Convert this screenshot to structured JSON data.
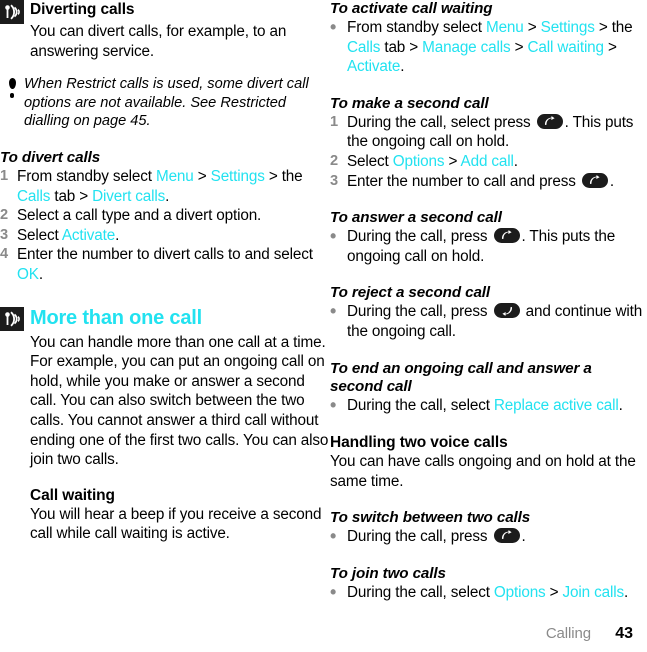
{
  "footer": {
    "chapter": "Calling",
    "page": "43"
  },
  "left": {
    "diverting": {
      "icon": "antenna-broadcast-icon",
      "heading": "Diverting calls",
      "intro": "You can divert calls, for example, to an answering service.",
      "note": {
        "icon": "exclamation-bullet-icon",
        "part1": "When ",
        "em1": "Restrict calls",
        "part2": " is used, some divert call options are not available. See ",
        "em2": "Restricted dialling",
        "part3": " on page 45."
      },
      "procedure": {
        "title": "To divert calls",
        "steps": [
          {
            "marker": "1",
            "segments": [
              {
                "t": "From standby select ",
                "c": "plain"
              },
              {
                "t": "Menu",
                "c": "menu"
              },
              {
                "t": " > ",
                "c": "plain"
              },
              {
                "t": "Settings",
                "c": "menu"
              },
              {
                "t": " > the ",
                "c": "plain"
              },
              {
                "t": "Calls",
                "c": "menu"
              },
              {
                "t": " tab > ",
                "c": "plain"
              },
              {
                "t": "Divert calls",
                "c": "menu"
              },
              {
                "t": ".",
                "c": "plain"
              }
            ]
          },
          {
            "marker": "2",
            "segments": [
              {
                "t": "Select a call type and a divert option.",
                "c": "plain"
              }
            ]
          },
          {
            "marker": "3",
            "segments": [
              {
                "t": "Select ",
                "c": "plain"
              },
              {
                "t": "Activate",
                "c": "menu"
              },
              {
                "t": ".",
                "c": "plain"
              }
            ]
          },
          {
            "marker": "4",
            "segments": [
              {
                "t": "Enter the number to divert calls to and select ",
                "c": "plain"
              },
              {
                "t": "OK",
                "c": "menu"
              },
              {
                "t": ".",
                "c": "plain"
              }
            ]
          }
        ]
      }
    },
    "more_than_one": {
      "icon": "antenna-broadcast-icon",
      "heading": "More than one call",
      "intro": "You can handle more than one call at a time. For example, you can put an ongoing call on hold, while you make or answer a second call. You can also switch between the two calls. You cannot answer a third call without ending one of the first two calls. You can also join two calls.",
      "call_waiting": {
        "heading": "Call waiting",
        "text": "You will hear a beep if you receive a second call while call waiting is active."
      }
    }
  },
  "right": {
    "activate_call_waiting": {
      "title": "To activate call waiting",
      "steps": [
        {
          "marker": "•",
          "segments": [
            {
              "t": "From standby select ",
              "c": "plain"
            },
            {
              "t": "Menu",
              "c": "menu"
            },
            {
              "t": " > ",
              "c": "plain"
            },
            {
              "t": "Settings",
              "c": "menu"
            },
            {
              "t": " > the ",
              "c": "plain"
            },
            {
              "t": "Calls",
              "c": "menu"
            },
            {
              "t": " tab > ",
              "c": "plain"
            },
            {
              "t": "Manage calls",
              "c": "menu"
            },
            {
              "t": " > ",
              "c": "plain"
            },
            {
              "t": "Call waiting",
              "c": "menu"
            },
            {
              "t": " > ",
              "c": "plain"
            },
            {
              "t": "Activate",
              "c": "menu"
            },
            {
              "t": ".",
              "c": "plain"
            }
          ]
        }
      ]
    },
    "make_second_call": {
      "title": "To make a second call",
      "steps": [
        {
          "marker": "1",
          "segments": [
            {
              "t": "During the call, select press ",
              "c": "plain"
            },
            {
              "t": "",
              "c": "call-key"
            },
            {
              "t": ". This puts the ongoing call on hold.",
              "c": "plain"
            }
          ]
        },
        {
          "marker": "2",
          "segments": [
            {
              "t": "Select ",
              "c": "plain"
            },
            {
              "t": "Options",
              "c": "menu"
            },
            {
              "t": " > ",
              "c": "plain"
            },
            {
              "t": "Add call",
              "c": "menu"
            },
            {
              "t": ".",
              "c": "plain"
            }
          ]
        },
        {
          "marker": "3",
          "segments": [
            {
              "t": "Enter the number to call and press ",
              "c": "plain"
            },
            {
              "t": "",
              "c": "call-key"
            },
            {
              "t": ".",
              "c": "plain"
            }
          ]
        }
      ]
    },
    "answer_second_call": {
      "title": "To answer a second call",
      "steps": [
        {
          "marker": "•",
          "segments": [
            {
              "t": "During the call, press ",
              "c": "plain"
            },
            {
              "t": "",
              "c": "call-key"
            },
            {
              "t": ". This puts the ongoing call on hold.",
              "c": "plain"
            }
          ]
        }
      ]
    },
    "reject_second_call": {
      "title": "To reject a second call",
      "steps": [
        {
          "marker": "•",
          "segments": [
            {
              "t": "During the call, press ",
              "c": "plain"
            },
            {
              "t": "",
              "c": "end-key"
            },
            {
              "t": " and continue with the ongoing call.",
              "c": "plain"
            }
          ]
        }
      ]
    },
    "end_and_answer": {
      "title": "To end an ongoing call and answer a second call",
      "steps": [
        {
          "marker": "•",
          "segments": [
            {
              "t": "During the call, select ",
              "c": "plain"
            },
            {
              "t": "Replace active call",
              "c": "menu"
            },
            {
              "t": ".",
              "c": "plain"
            }
          ]
        }
      ]
    },
    "handling_two": {
      "heading": "Handling two voice calls",
      "text": "You can have calls ongoing and on hold at the same time."
    },
    "switch_two_calls": {
      "title": "To switch between two calls",
      "steps": [
        {
          "marker": "•",
          "segments": [
            {
              "t": "During the call, press ",
              "c": "plain"
            },
            {
              "t": "",
              "c": "call-key"
            },
            {
              "t": ".",
              "c": "plain"
            }
          ]
        }
      ]
    },
    "join_two_calls": {
      "title": "To join two calls",
      "steps": [
        {
          "marker": "•",
          "segments": [
            {
              "t": "During the call, select ",
              "c": "plain"
            },
            {
              "t": "Options",
              "c": "menu"
            },
            {
              "t": " > ",
              "c": "plain"
            },
            {
              "t": "Join calls",
              "c": "menu"
            },
            {
              "t": ".",
              "c": "plain"
            }
          ]
        }
      ]
    }
  },
  "colors": {
    "accent": "#22e2f0",
    "muted": "#8a8a8a",
    "ink": "#000000",
    "badge": "#1c1c1c"
  }
}
